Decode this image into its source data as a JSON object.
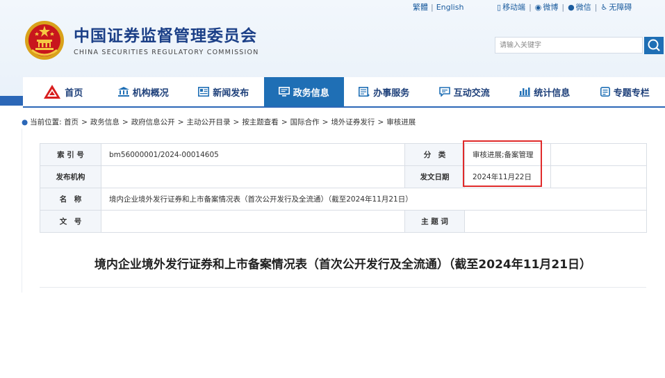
{
  "top_links": {
    "traditional": "繁體",
    "english": "English"
  },
  "right_links": {
    "mobile": "移动端",
    "weibo": "微博",
    "wechat": "微信",
    "accessible": "无障碍"
  },
  "logo": {
    "title_cn": "中国证券监督管理委员会",
    "title_en": "CHINA SECURITIES REGULATORY COMMISSION"
  },
  "search": {
    "placeholder": "请输入关键字"
  },
  "nav": [
    {
      "label": "首页",
      "icon": "logo-mark-icon"
    },
    {
      "label": "机构概况",
      "icon": "building-icon"
    },
    {
      "label": "新闻发布",
      "icon": "news-icon"
    },
    {
      "label": "政务信息",
      "icon": "monitor-icon",
      "active": true
    },
    {
      "label": "办事服务",
      "icon": "service-icon"
    },
    {
      "label": "互动交流",
      "icon": "chat-icon"
    },
    {
      "label": "统计信息",
      "icon": "bar-chart-icon"
    },
    {
      "label": "专题专栏",
      "icon": "document-icon"
    }
  ],
  "breadcrumb": {
    "prefix": "当前位置:",
    "items": [
      "首页",
      "政务信息",
      "政府信息公开",
      "主动公开目录",
      "按主题查看",
      "国际合作",
      "境外证券发行",
      "审核进展"
    ]
  },
  "meta": {
    "index_label": "索 引 号",
    "index_value": "bm56000001/2024-00014605",
    "category_label": "分　类",
    "category_value": "审核进展;备案管理",
    "publisher_label": "发布机构",
    "publisher_value": "",
    "date_label": "发文日期",
    "date_value": "2024年11月22日",
    "name_label": "名　称",
    "name_value": "境内企业境外发行证券和上市备案情况表（首次公开发行及全流通）（截至2024年11月21日）",
    "docno_label": "文　号",
    "docno_value": "",
    "subject_label": "主 题 词",
    "subject_value": ""
  },
  "document": {
    "title": "境内企业境外发行证券和上市备案情况表（首次公开发行及全流通）（截至2024年11月21日）"
  },
  "colors": {
    "brand_blue": "#1f6fb5",
    "nav_text": "#1d3f79",
    "highlight_red": "#e02a2a"
  }
}
